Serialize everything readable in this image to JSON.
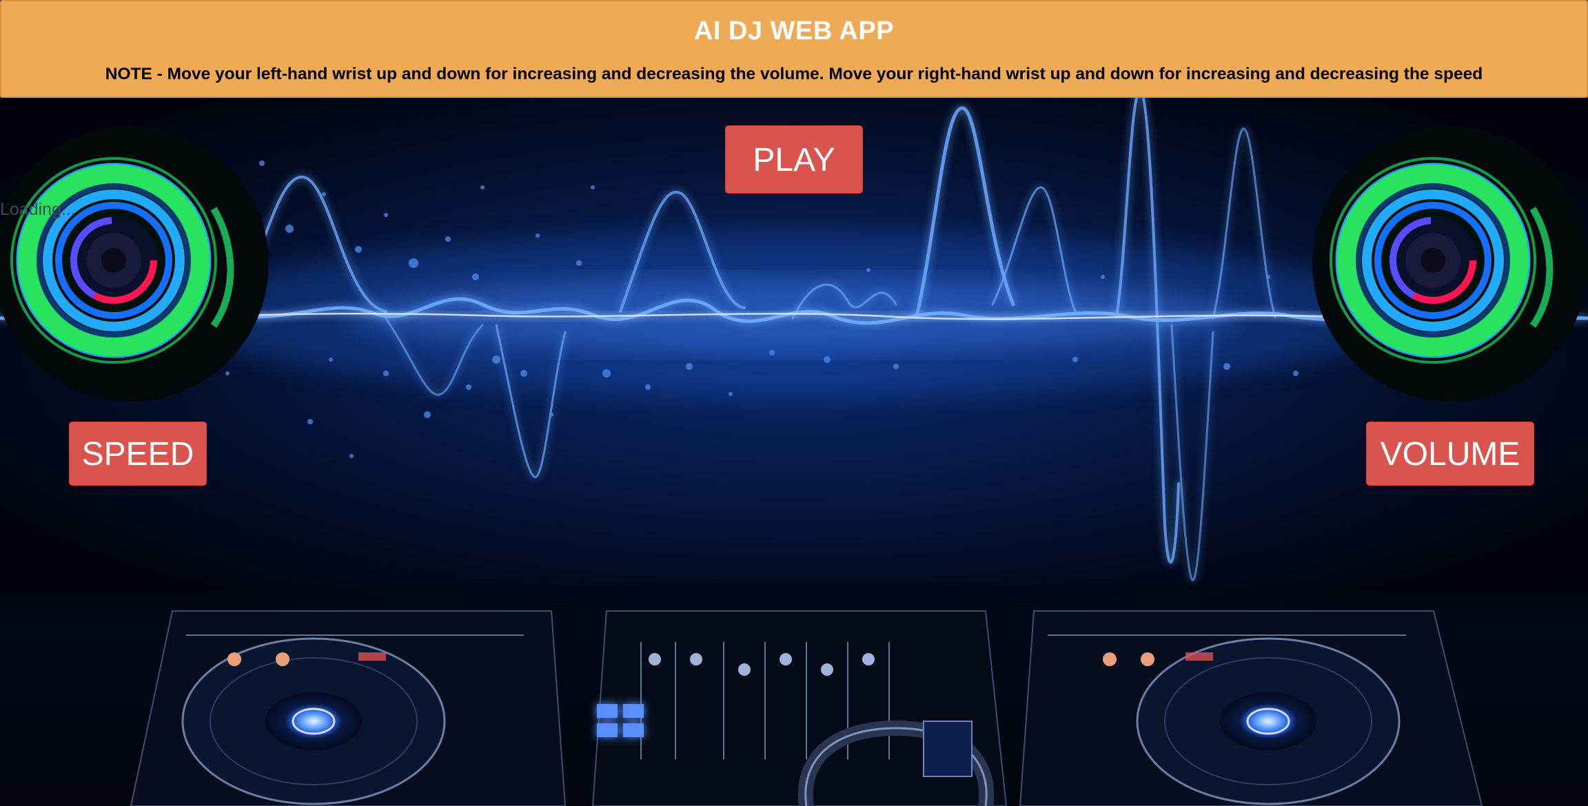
{
  "header": {
    "title": "AI DJ WEB APP",
    "note": "NOTE - Move your left-hand wrist up and down for increasing and decreasing the volume. Move your right-hand wrist up and down for increasing and decreasing the speed"
  },
  "controls": {
    "play_label": "PLAY",
    "speed_label": "SPEED",
    "volume_label": "VOLUME"
  },
  "status": {
    "loading_text": "Loading..."
  },
  "colors": {
    "header_bg": "#eeaa55",
    "button_bg": "#d9534f",
    "button_text": "#ffffff",
    "note_text": "#000000"
  }
}
